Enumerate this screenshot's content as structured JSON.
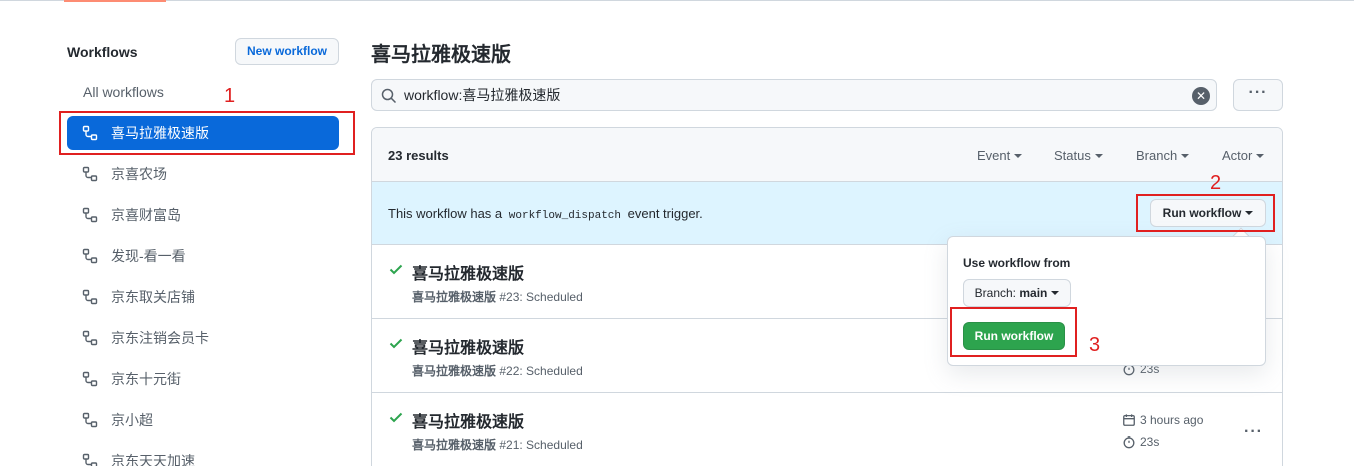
{
  "sidebar": {
    "title": "Workflows",
    "new_button": "New workflow",
    "all_label": "All workflows",
    "items": [
      {
        "label": "喜马拉雅极速版"
      },
      {
        "label": "京喜农场"
      },
      {
        "label": "京喜财富岛"
      },
      {
        "label": "发现-看一看"
      },
      {
        "label": "京东取关店铺"
      },
      {
        "label": "京东注销会员卡"
      },
      {
        "label": "京东十元街"
      },
      {
        "label": "京小超"
      },
      {
        "label": "京东天天加速"
      }
    ]
  },
  "main": {
    "title": "喜马拉雅极速版",
    "search": {
      "value": "workflow:喜马拉雅极速版"
    },
    "results_count": "23 results",
    "filters": {
      "event": "Event",
      "status": "Status",
      "branch": "Branch",
      "actor": "Actor"
    },
    "dispatch": {
      "prefix": "This workflow has a",
      "code": "workflow_dispatch",
      "suffix": "event trigger.",
      "button": "Run workflow"
    },
    "runs": [
      {
        "title": "喜马拉雅极速版",
        "workflow": "喜马拉雅极速版",
        "meta": "#23: Scheduled",
        "time": "",
        "duration": ""
      },
      {
        "title": "喜马拉雅极速版",
        "workflow": "喜马拉雅极速版",
        "meta": "#22: Scheduled",
        "time": "",
        "duration": "23s"
      },
      {
        "title": "喜马拉雅极速版",
        "workflow": "喜马拉雅极速版",
        "meta": "#21: Scheduled",
        "time": "3 hours ago",
        "duration": "23s"
      }
    ]
  },
  "popover": {
    "label": "Use workflow from",
    "branch_prefix": "Branch:",
    "branch": "main",
    "run_button": "Run workflow"
  },
  "annotations": {
    "one": "1",
    "two": "2",
    "three": "3"
  },
  "colors": {
    "accent": "#0969da",
    "success": "#2da44e",
    "annotation": "#e02020",
    "dispatch_bg": "#ddf4ff"
  }
}
